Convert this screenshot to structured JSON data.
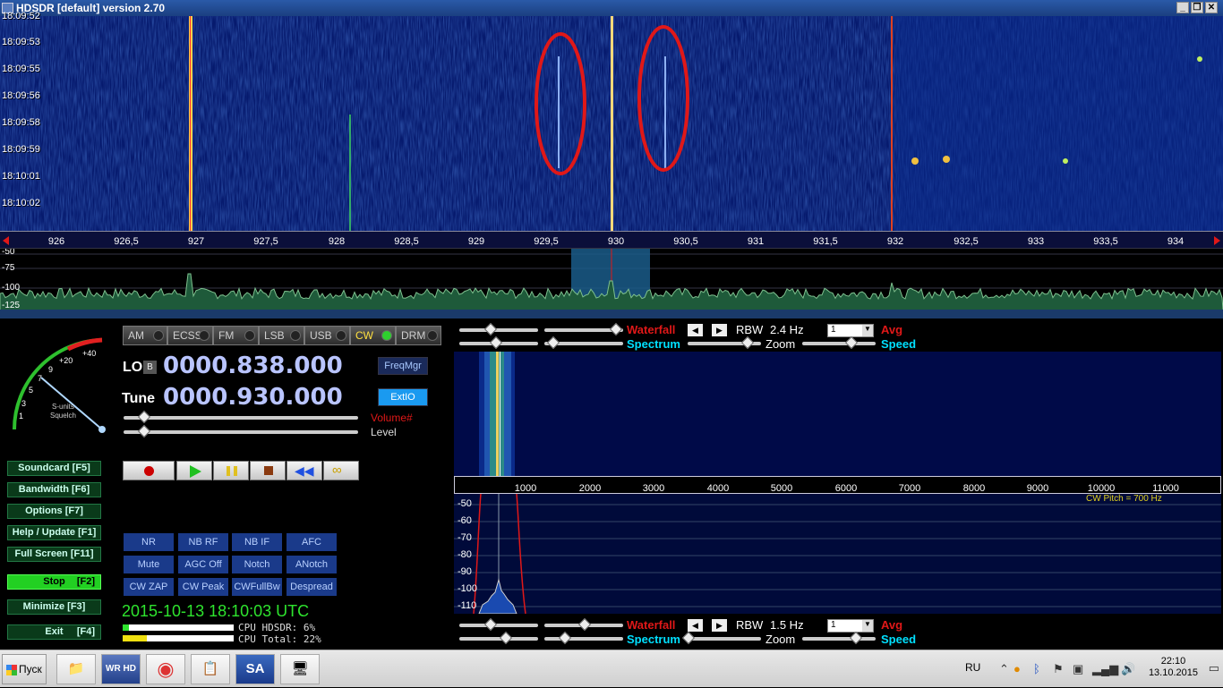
{
  "window": {
    "title": "HDSDR [default]  version 2.70"
  },
  "waterfall_top": {
    "timestamps": [
      "18:09:52",
      "18:09:53",
      "18:09:55",
      "18:09:56",
      "18:09:58",
      "18:09:59",
      "18:10:01",
      "18:10:02"
    ],
    "freq_labels": [
      "926",
      "926,5",
      "927",
      "927,5",
      "928",
      "928,5",
      "929",
      "929,5",
      "930",
      "930,5",
      "931",
      "931,5",
      "932",
      "932,5",
      "933",
      "933,5",
      "934"
    ]
  },
  "spectrum_top": {
    "db_labels": [
      "-50",
      "-75",
      "-100",
      "-125"
    ]
  },
  "modes": [
    {
      "label": "AM",
      "active": false
    },
    {
      "label": "ECSS",
      "active": false
    },
    {
      "label": "FM",
      "active": false
    },
    {
      "label": "LSB",
      "active": false
    },
    {
      "label": "USB",
      "active": false
    },
    {
      "label": "CW",
      "active": true
    },
    {
      "label": "DRM",
      "active": false
    }
  ],
  "meter": {
    "scale": [
      "1",
      "3",
      "5",
      "7",
      "9",
      "+20",
      "+40"
    ],
    "caption1": "S-units",
    "caption2": "Squelch"
  },
  "lo": {
    "label": "LO",
    "badge": "B",
    "value": "0000.838.000"
  },
  "tune": {
    "label": "Tune",
    "value": "0000.930.000"
  },
  "buttons": {
    "freqmgr": "FreqMgr",
    "extio": "ExtIO"
  },
  "sliders": {
    "volume_label": "Volume#",
    "level_label": "Level"
  },
  "left_buttons": [
    {
      "label": "Soundcard  [F5]"
    },
    {
      "label": "Bandwidth  [F6]"
    },
    {
      "label": "Options    [F7]"
    },
    {
      "label": "Help / Update  [F1]"
    },
    {
      "label": "Full Screen  [F11]"
    }
  ],
  "stop_button": {
    "label": "Stop",
    "key": "[F2]"
  },
  "minimize_button": {
    "label": "Minimize  [F3]"
  },
  "exit_button": {
    "label": "Exit",
    "key": "[F4]"
  },
  "dsp_buttons": [
    [
      "NR",
      "NB RF",
      "NB IF",
      "AFC"
    ],
    [
      "Mute",
      "AGC Off",
      "Notch",
      "ANotch"
    ],
    [
      "CW ZAP",
      "CW Peak",
      "CWFullBw",
      "Despread"
    ]
  ],
  "clock": "2015-10-13   18:10:03 UTC",
  "cpu": {
    "hdsdr_label": "CPU HDSDR:  6%",
    "total_label": "CPU Total: 22%",
    "hdsdr_pct": 6,
    "total_pct": 22
  },
  "ctl_top": {
    "waterfall": "Waterfall",
    "spectrum": "Spectrum",
    "rbw_label": "RBW",
    "rbw_value": "2.4 Hz",
    "avg_value": "1",
    "avg_label": "Avg",
    "zoom_label": "Zoom",
    "speed_label": "Speed"
  },
  "ctl_bottom": {
    "waterfall": "Waterfall",
    "spectrum": "Spectrum",
    "rbw_label": "RBW",
    "rbw_value": "1.5 Hz",
    "avg_value": "1",
    "avg_label": "Avg",
    "zoom_label": "Zoom",
    "speed_label": "Speed"
  },
  "zoom_axis": {
    "labels": [
      "1000",
      "2000",
      "3000",
      "4000",
      "5000",
      "6000",
      "7000",
      "8000",
      "9000",
      "10000",
      "11000"
    ]
  },
  "zoom_spectrum": {
    "db_labels": [
      "-50",
      "-60",
      "-70",
      "-80",
      "-90",
      "-100",
      "-110"
    ],
    "annotation": "CW Pitch = 700 Hz"
  },
  "colors": {
    "accent_red": "#e01818",
    "spectrum_cyan": "#00e0ff",
    "clock_green": "#2ee42e",
    "stop_green": "#22d022"
  },
  "taskbar": {
    "start_label": "Пуск",
    "apps": [
      "folder-icon",
      "winrad-hd-icon",
      "chrome-icon",
      "files-icon",
      "sa-icon",
      "monitor-icon"
    ],
    "lang": "RU",
    "time": "22:10",
    "date": "13.10.2015"
  }
}
